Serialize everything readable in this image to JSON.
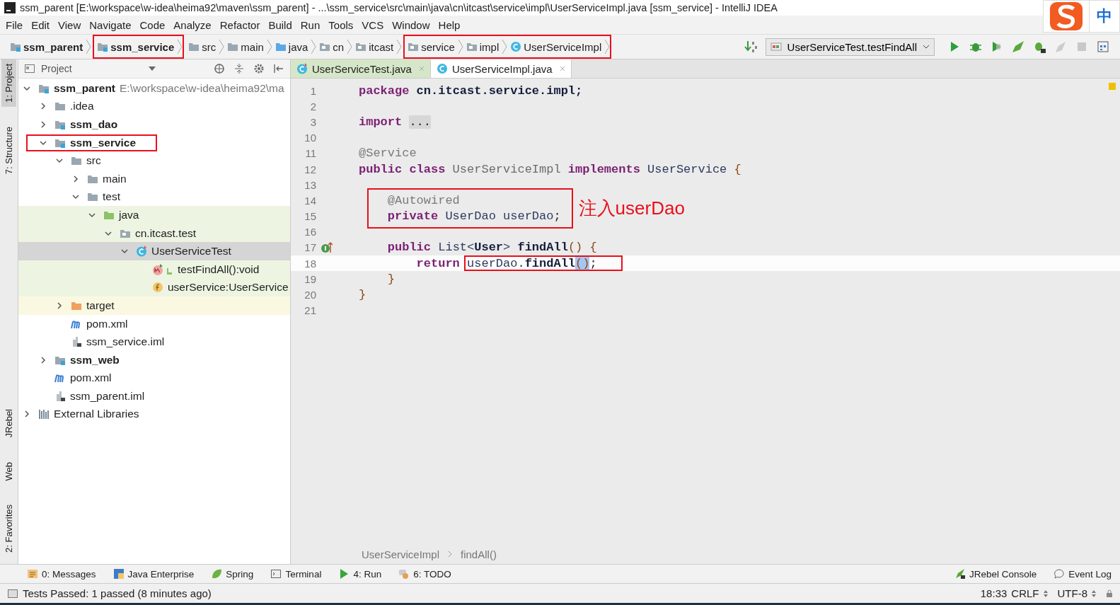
{
  "window": {
    "title": "ssm_parent [E:\\workspace\\w-idea\\heima92\\maven\\ssm_parent] - ...\\ssm_service\\src\\main\\java\\cn\\itcast\\service\\impl\\UserServiceImpl.java [ssm_service] - IntelliJ IDEA"
  },
  "ime": {
    "label": "中"
  },
  "menu": [
    "File",
    "Edit",
    "View",
    "Navigate",
    "Code",
    "Analyze",
    "Refactor",
    "Build",
    "Run",
    "Tools",
    "VCS",
    "Window",
    "Help"
  ],
  "nav_bar": {
    "breadcrumbs": [
      {
        "label": "ssm_parent",
        "kind": "module",
        "bold": true,
        "boxed": false
      },
      {
        "label": "ssm_service",
        "kind": "module",
        "bold": true,
        "boxed": true
      },
      {
        "label": "src",
        "kind": "folder",
        "bold": false,
        "boxed": false
      },
      {
        "label": "main",
        "kind": "folder",
        "bold": false,
        "boxed": false
      },
      {
        "label": "java",
        "kind": "source-folder",
        "bold": false,
        "boxed": false
      },
      {
        "label": "cn",
        "kind": "package",
        "bold": false,
        "boxed": false
      },
      {
        "label": "itcast",
        "kind": "package",
        "bold": false,
        "boxed": false
      },
      {
        "label": "service",
        "kind": "package",
        "bold": false,
        "boxed": true
      },
      {
        "label": "impl",
        "kind": "package",
        "bold": false,
        "boxed": true
      },
      {
        "label": "UserServiceImpl",
        "kind": "class",
        "bold": false,
        "boxed": true
      }
    ],
    "run_config": "UserServiceTest.testFindAll"
  },
  "left_strip": {
    "top": [
      {
        "label": "1: Project",
        "selected": true
      },
      {
        "label": "7: Structure",
        "selected": false
      }
    ],
    "bottom": [
      {
        "label": "JRebel",
        "selected": false
      },
      {
        "label": "Web",
        "selected": false
      },
      {
        "label": "2: Favorites",
        "selected": false
      }
    ]
  },
  "project": {
    "title": "Project",
    "tree": [
      {
        "label": "ssm_parent",
        "path": "E:\\workspace\\w-idea\\heima92\\ma",
        "kind": "module",
        "bold": true,
        "expanded": true,
        "children": [
          {
            "label": ".idea",
            "kind": "folder",
            "expanded": false
          },
          {
            "label": "ssm_dao",
            "kind": "module",
            "bold": true,
            "expanded": false
          },
          {
            "label": "ssm_service",
            "kind": "module",
            "bold": true,
            "boxed": true,
            "expanded": true,
            "children": [
              {
                "label": "src",
                "kind": "folder",
                "expanded": true,
                "children": [
                  {
                    "label": "main",
                    "kind": "folder",
                    "expanded": false
                  },
                  {
                    "label": "test",
                    "kind": "folder",
                    "expanded": true,
                    "children": [
                      {
                        "label": "java",
                        "kind": "test-folder",
                        "expanded": true,
                        "children": [
                          {
                            "label": "cn.itcast.test",
                            "kind": "package",
                            "expanded": true,
                            "children": [
                              {
                                "label": "UserServiceTest",
                                "kind": "test-class",
                                "selected": true,
                                "expanded": true,
                                "children": [
                                  {
                                    "label": "testFindAll():void",
                                    "kind": "method"
                                  },
                                  {
                                    "label": "userService:UserService",
                                    "kind": "field"
                                  }
                                ]
                              }
                            ]
                          }
                        ]
                      }
                    ]
                  }
                ]
              },
              {
                "label": "target",
                "kind": "excluded-folder",
                "expanded": false
              },
              {
                "label": "pom.xml",
                "kind": "maven"
              },
              {
                "label": "ssm_service.iml",
                "kind": "iml"
              }
            ]
          },
          {
            "label": "ssm_web",
            "kind": "module",
            "bold": true,
            "expanded": false
          },
          {
            "label": "pom.xml",
            "kind": "maven"
          },
          {
            "label": "ssm_parent.iml",
            "kind": "iml"
          }
        ]
      },
      {
        "label": "External Libraries",
        "kind": "libraries",
        "expanded": false
      }
    ]
  },
  "editor": {
    "tabs": [
      {
        "label": "UserServiceTest.java",
        "kind": "test-class",
        "selected": false
      },
      {
        "label": "UserServiceImpl.java",
        "kind": "class",
        "selected": true
      }
    ],
    "lines": [
      {
        "number": "1",
        "segments": [
          {
            "text": "package",
            "kind": "keyword"
          },
          {
            "text": " cn.itcast.service.impl;",
            "kind": "bold"
          }
        ]
      },
      {
        "number": "2"
      },
      {
        "number": "3",
        "segments": [
          {
            "text": "import",
            "kind": "keyword"
          },
          {
            "text": "...",
            "kind": "fold"
          }
        ]
      },
      {
        "number": "10"
      },
      {
        "number": "11",
        "segments": [
          {
            "text": "@Service",
            "kind": "annotation"
          }
        ]
      },
      {
        "number": "12",
        "segments": [
          {
            "text": "public class",
            "kind": "keyword"
          },
          {
            "text": " UserServiceImpl",
            "kind": "unused"
          },
          {
            "text": " implements",
            "kind": "keyword"
          },
          {
            "text": " UserService",
            "kind": "type"
          },
          {
            "text": " {",
            "kind": "brace"
          }
        ]
      },
      {
        "number": "13"
      },
      {
        "number": "14",
        "boxed": true,
        "segments": [
          {
            "text": "    @Autowired",
            "kind": "annotation"
          }
        ]
      },
      {
        "number": "15",
        "boxed": true,
        "segments": [
          {
            "text": "    private",
            "kind": "keyword"
          },
          {
            "text": " UserDao userDao",
            "kind": "type"
          },
          {
            "text": ";",
            "kind": "plain"
          }
        ]
      },
      {
        "number": "16"
      },
      {
        "number": "17",
        "marker": true,
        "segments": [
          {
            "text": "    public",
            "kind": "keyword"
          },
          {
            "text": " List<",
            "kind": "type"
          },
          {
            "text": "User",
            "kind": "bold"
          },
          {
            "text": ">",
            "kind": "type"
          },
          {
            "text": " findAll",
            "kind": "bold"
          },
          {
            "text": "()",
            "kind": "brace"
          },
          {
            "text": " {",
            "kind": "brace"
          }
        ]
      },
      {
        "number": "18",
        "current": true,
        "segments": [
          {
            "text": "        return",
            "kind": "keyword"
          },
          {
            "text": " userDao.",
            "kind": "type",
            "boxed": true
          },
          {
            "text": "findAll",
            "kind": "bold",
            "boxed": true
          },
          {
            "text": "()",
            "kind": "brace",
            "boxed": true,
            "selected": true
          },
          {
            "text": ";",
            "kind": "plain",
            "boxed": true
          }
        ]
      },
      {
        "number": "19",
        "segments": [
          {
            "text": "    }",
            "kind": "brace"
          }
        ]
      },
      {
        "number": "20",
        "segments": [
          {
            "text": "}",
            "kind": "brace"
          }
        ]
      },
      {
        "number": "21"
      }
    ],
    "note": "注入userDao",
    "breadcrumb": [
      "UserServiceImpl",
      "findAll()"
    ]
  },
  "tool_windows": {
    "left": [
      {
        "label": "0: Messages",
        "kind": "messages"
      },
      {
        "label": "Java Enterprise",
        "kind": "enterprise"
      },
      {
        "label": "Spring",
        "kind": "spring"
      },
      {
        "label": "Terminal",
        "kind": "terminal"
      },
      {
        "label": "4: Run",
        "kind": "run"
      },
      {
        "label": "6: TODO",
        "kind": "todo"
      }
    ],
    "right": [
      {
        "label": "JRebel Console",
        "kind": "jrebel"
      },
      {
        "label": "Event Log",
        "kind": "event-log"
      }
    ]
  },
  "status_bar": {
    "message": "Tests Passed: 1 passed (8 minutes ago)",
    "position": "18:33",
    "line_separator": "CRLF",
    "encoding": "UTF-8"
  }
}
